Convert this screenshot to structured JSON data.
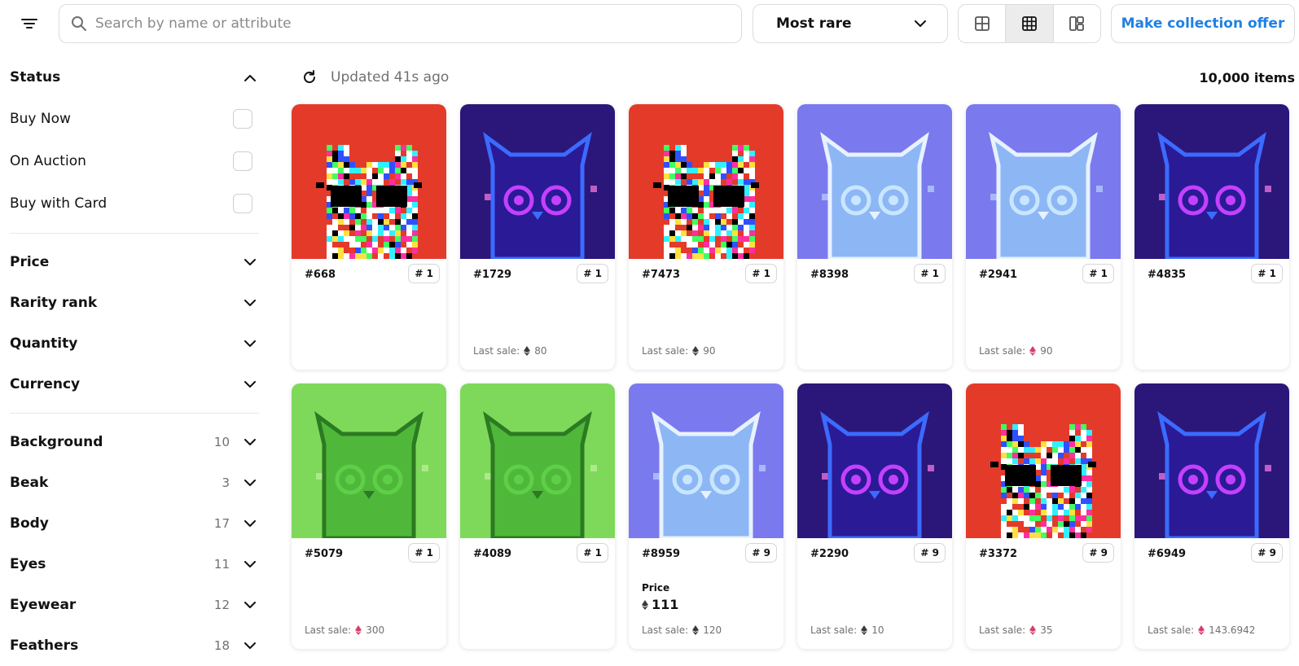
{
  "search": {
    "placeholder": "Search by name or attribute"
  },
  "sort": {
    "selected": "Most rare"
  },
  "offer_label": "Make collection offer",
  "status_bar": {
    "updated": "Updated 41s ago",
    "count": "10,000 items"
  },
  "sidebar": {
    "status": {
      "title": "Status",
      "options": [
        "Buy Now",
        "On Auction",
        "Buy with Card"
      ]
    },
    "sections": [
      "Price",
      "Rarity rank",
      "Quantity",
      "Currency"
    ],
    "traits": [
      {
        "name": "Background",
        "count": "10"
      },
      {
        "name": "Beak",
        "count": "3"
      },
      {
        "name": "Body",
        "count": "17"
      },
      {
        "name": "Eyes",
        "count": "11"
      },
      {
        "name": "Eyewear",
        "count": "12"
      },
      {
        "name": "Feathers",
        "count": "18"
      }
    ]
  },
  "cards": [
    {
      "name": "#668",
      "rank": "# 1",
      "art": "glitch",
      "last_sale": "",
      "last_sale_prefix": "",
      "currency": ""
    },
    {
      "name": "#1729",
      "rank": "# 1",
      "art": "cosmic",
      "last_sale": "80",
      "last_sale_prefix": "Last sale:",
      "currency": "eth"
    },
    {
      "name": "#7473",
      "rank": "# 1",
      "art": "glitch",
      "last_sale": "90",
      "last_sale_prefix": "Last sale:",
      "currency": "eth"
    },
    {
      "name": "#8398",
      "rank": "# 1",
      "art": "ghost",
      "last_sale": "",
      "last_sale_prefix": "",
      "currency": ""
    },
    {
      "name": "#2941",
      "rank": "# 1",
      "art": "ghost",
      "last_sale": "90",
      "last_sale_prefix": "Last sale:",
      "currency": "weth"
    },
    {
      "name": "#4835",
      "rank": "# 1",
      "art": "cosmic",
      "last_sale": "",
      "last_sale_prefix": "",
      "currency": ""
    },
    {
      "name": "#5079",
      "rank": "# 1",
      "art": "green",
      "last_sale": "300",
      "last_sale_prefix": "Last sale:",
      "currency": "weth"
    },
    {
      "name": "#4089",
      "rank": "# 1",
      "art": "green",
      "last_sale": "",
      "last_sale_prefix": "",
      "currency": ""
    },
    {
      "name": "#8959",
      "rank": "# 9",
      "art": "ghost",
      "price_label": "Price",
      "price": "111",
      "last_sale": "120",
      "last_sale_prefix": "Last sale:",
      "currency": "eth"
    },
    {
      "name": "#2290",
      "rank": "# 9",
      "art": "cosmic",
      "last_sale": "10",
      "last_sale_prefix": "Last sale:",
      "currency": "eth"
    },
    {
      "name": "#3372",
      "rank": "# 9",
      "art": "glitch",
      "last_sale": "35",
      "last_sale_prefix": "Last sale:",
      "currency": "weth"
    },
    {
      "name": "#6949",
      "rank": "# 9",
      "art": "cosmic",
      "last_sale": "143.6942",
      "last_sale_prefix": "Last sale:",
      "currency": "weth"
    }
  ],
  "colors": {
    "accent": "#2081e2",
    "glitch_bg": "#e43a2a",
    "cosmic_bg": "#2b1779",
    "ghost_bg": "#7b79ee",
    "green_bg": "#7ed95a",
    "eth": "#3a3a3a",
    "weth": "#d43f6a"
  },
  "icons": [
    "filter-icon",
    "search-icon",
    "chevron-down-icon",
    "grid-large-icon",
    "grid-small-icon",
    "grid-mosaic-icon",
    "refresh-icon",
    "chevron-up-icon",
    "eth-icon",
    "weth-icon"
  ]
}
